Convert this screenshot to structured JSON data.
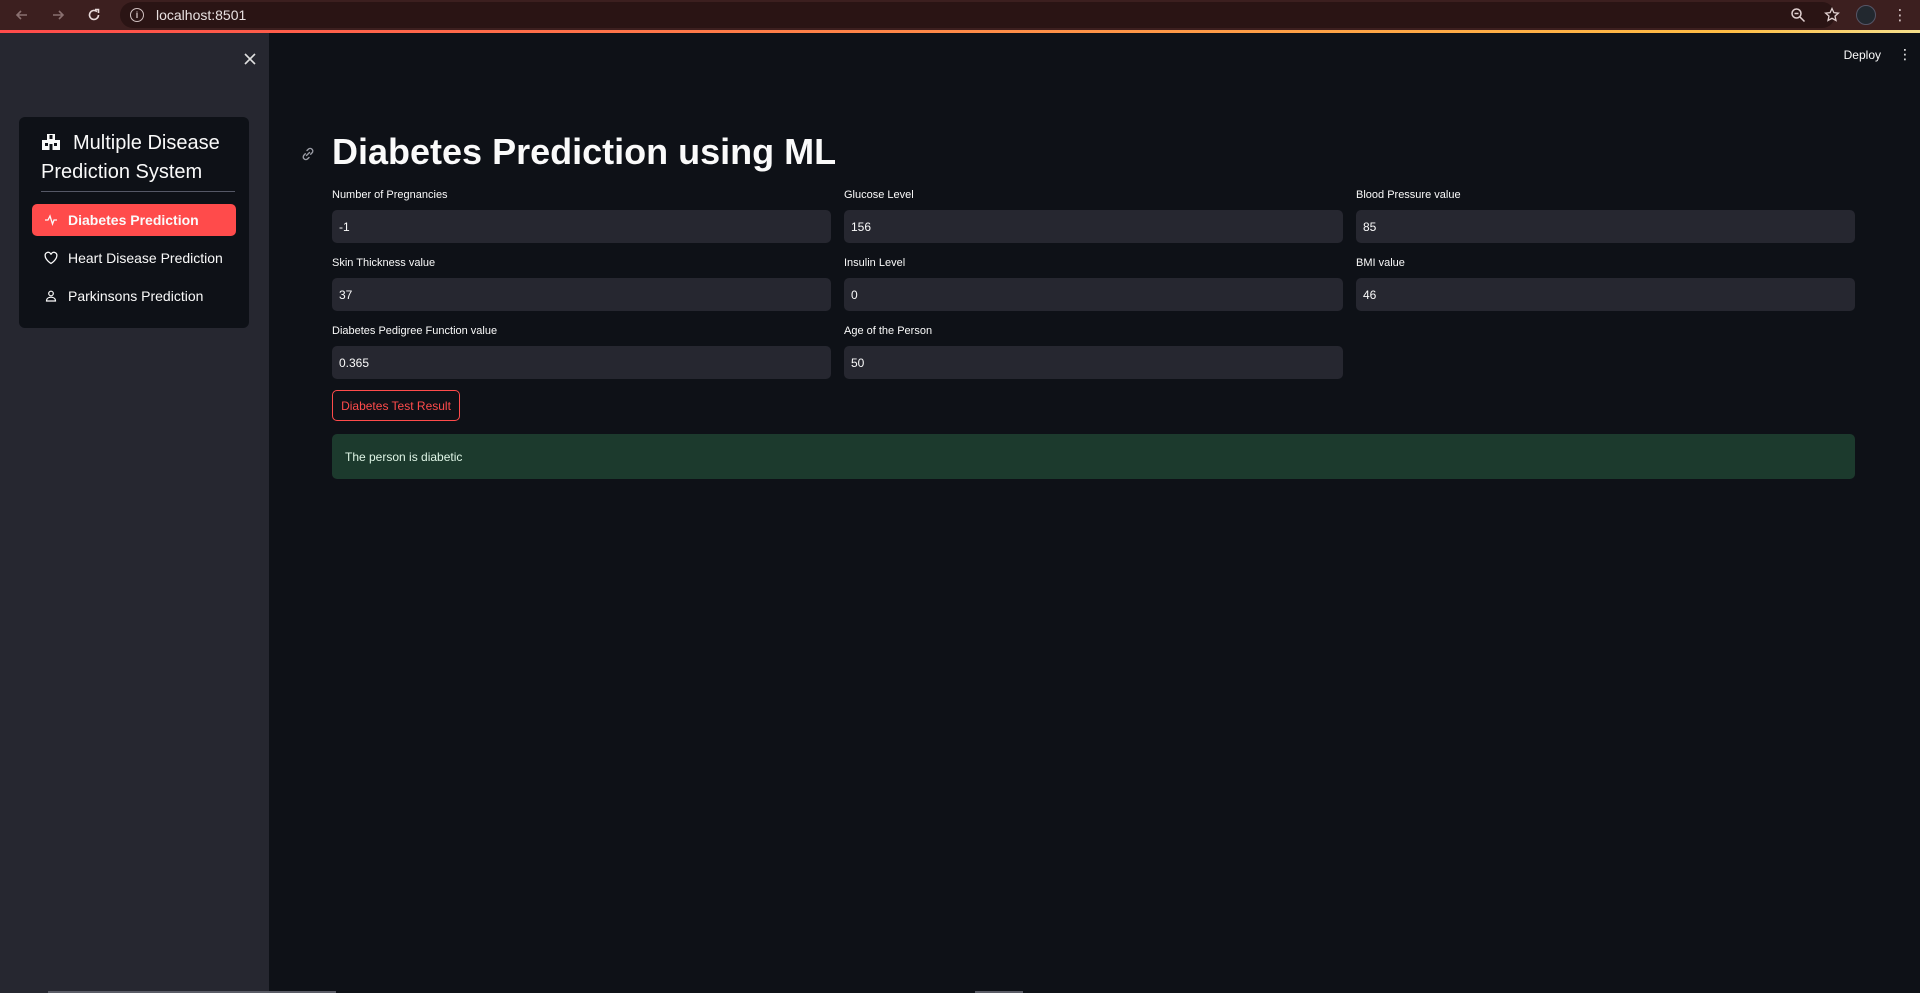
{
  "browser": {
    "url": "localhost:8501"
  },
  "header": {
    "deploy_label": "Deploy"
  },
  "sidebar": {
    "menu_title": "Multiple Disease Prediction System",
    "items": [
      {
        "label": "Diabetes Prediction",
        "icon": "activity-icon",
        "selected": true
      },
      {
        "label": "Heart Disease Prediction",
        "icon": "heart-icon",
        "selected": false
      },
      {
        "label": "Parkinsons Prediction",
        "icon": "person-icon",
        "selected": false
      }
    ]
  },
  "main": {
    "title": "Diabetes Prediction using ML",
    "fields": [
      {
        "label": "Number of Pregnancies",
        "value": "-1"
      },
      {
        "label": "Glucose Level",
        "value": "156"
      },
      {
        "label": "Blood Pressure value",
        "value": "85"
      },
      {
        "label": "Skin Thickness value",
        "value": "37"
      },
      {
        "label": "Insulin Level",
        "value": "0"
      },
      {
        "label": "BMI value",
        "value": "46"
      },
      {
        "label": "Diabetes Pedigree Function value",
        "value": "0.365"
      },
      {
        "label": "Age of the Person",
        "value": "50"
      }
    ],
    "button_label": "Diabetes Test Result",
    "result_text": "The person is diabetic"
  },
  "colors": {
    "accent": "#ff4b4b",
    "background": "#0e1117",
    "sidebar": "#262730",
    "success_bg": "#1c3a2d"
  }
}
